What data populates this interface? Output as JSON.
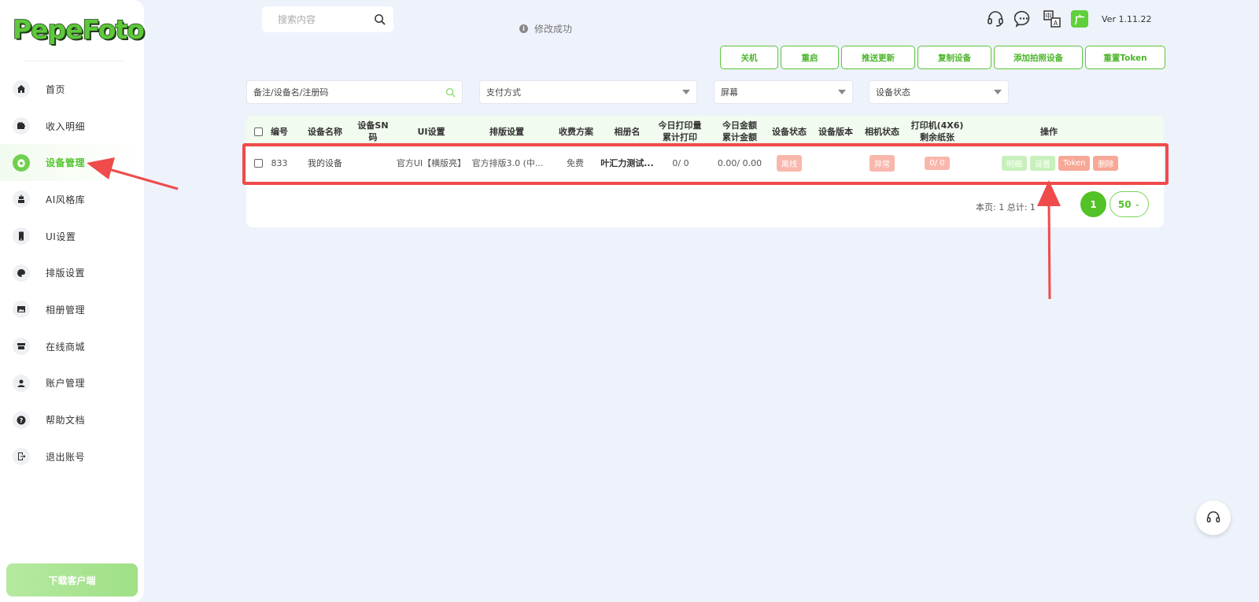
{
  "brand": {
    "logo_text": "PepeFoto",
    "accent": "#52c227"
  },
  "sidebar": {
    "items": [
      {
        "label": "首页",
        "icon": "home-icon"
      },
      {
        "label": "收入明细",
        "icon": "wallet-icon"
      },
      {
        "label": "设备管理",
        "icon": "gear-icon",
        "active": true
      },
      {
        "label": "AI风格库",
        "icon": "robot-icon"
      },
      {
        "label": "UI设置",
        "icon": "phone-icon"
      },
      {
        "label": "排版设置",
        "icon": "palette-icon"
      },
      {
        "label": "相册管理",
        "icon": "image-icon"
      },
      {
        "label": "在线商城",
        "icon": "store-icon"
      },
      {
        "label": "账户管理",
        "icon": "user-icon"
      },
      {
        "label": "帮助文档",
        "icon": "help-icon"
      },
      {
        "label": "退出账号",
        "icon": "logout-icon"
      }
    ],
    "download_label": "下载客户端"
  },
  "header": {
    "search_placeholder": "搜索内容",
    "toast": "修改成功",
    "version": "Ver 1.11.22",
    "badge_char": "广"
  },
  "actions": [
    "关机",
    "重启",
    "推送更新",
    "复制设备",
    "添加拍照设备",
    "重置Token"
  ],
  "filters": {
    "keyword_placeholder": "备注/设备名/注册码",
    "payment": "支付方式",
    "screen": "屏幕",
    "status": "设备状态"
  },
  "table": {
    "headers": [
      "编号",
      "设备名称",
      "设备SN码",
      "UI设置",
      "排版设置",
      "收费方案",
      "相册名",
      "今日打印量\n累计打印",
      "今日金额\n累计金额",
      "设备状态",
      "设备版本",
      "相机状态",
      "打印机(4X6)\n剩余纸张",
      "操作"
    ],
    "rows": [
      {
        "id": "833",
        "name": "我的设备",
        "sn": "",
        "ui": "官方UI【横版亮】",
        "layout": "官方排版3.0 (中...",
        "plan": "免费",
        "album": "叶汇力测试...",
        "prints": "0/ 0",
        "amount": "0.00/ 0.00",
        "status": "离线",
        "version": "",
        "camera": "异常",
        "printer": "0/ 0",
        "ops": [
          "明细",
          "设置",
          "Token",
          "删除"
        ]
      }
    ]
  },
  "pager": {
    "text": "本页: 1   总计: 1",
    "current": "1",
    "page_size": "50"
  }
}
